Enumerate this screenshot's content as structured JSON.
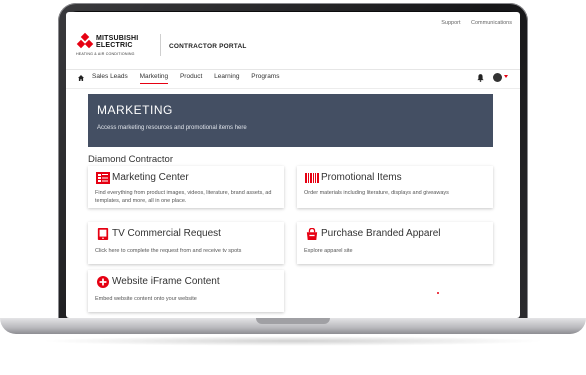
{
  "util_links": [
    "Support",
    "Communications"
  ],
  "brand": {
    "line1": "MITSUBISHI",
    "line2": "ELECTRIC",
    "line3": "HEATING & AIR CONDITIONING",
    "portal": "CONTRACTOR PORTAL"
  },
  "nav": {
    "items": [
      "Sales Leads",
      "Marketing",
      "Product",
      "Learning",
      "Programs"
    ],
    "active": "Marketing"
  },
  "hero": {
    "title": "MARKETING",
    "subtitle": "Access marketing resources and promotional items here"
  },
  "section_title": "Diamond Contractor",
  "cards": [
    {
      "title": "Marketing Center",
      "desc": "Find everything from product images, videos, literature, brand assets, ad templates, and more, all in one place.",
      "icon": "marketing-center-icon"
    },
    {
      "title": "Promotional Items",
      "desc": "Order materials including literature, displays and giveaways",
      "icon": "barcode-icon"
    },
    {
      "title": "TV Commercial Request",
      "desc": "Click here to complete the request from and receive tv spots",
      "icon": "tablet-icon"
    },
    {
      "title": "Purchase Branded Apparel",
      "desc": "Explore apparel site",
      "icon": "shopping-bag-icon"
    },
    {
      "title": "Website iFrame Content",
      "desc": "Embed website content onto your website",
      "icon": "plus-circle-icon"
    }
  ],
  "colors": {
    "accent": "#e60012",
    "hero_bg": "#444f63"
  }
}
